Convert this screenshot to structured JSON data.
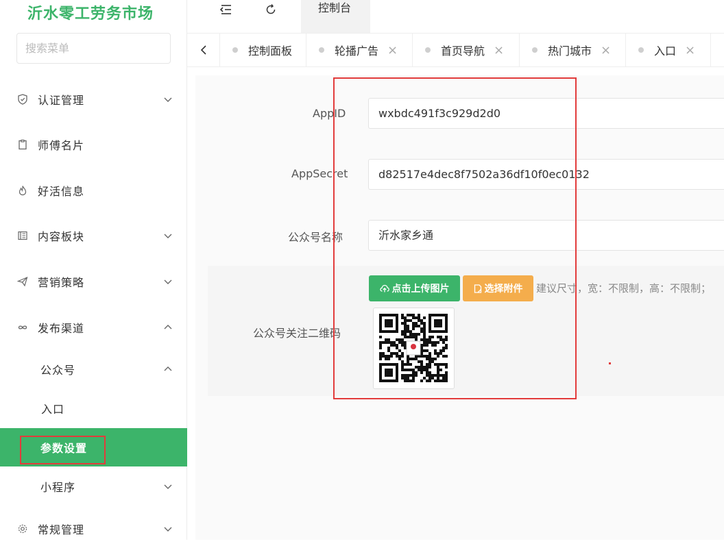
{
  "sidebar": {
    "brand": "沂水零工劳务市场",
    "search_placeholder": "搜索菜单",
    "items": [
      {
        "label": "认证管理",
        "icon": "shield-icon"
      },
      {
        "label": "师傅名片",
        "icon": "clipboard-icon"
      },
      {
        "label": "好活信息",
        "icon": "fire-icon"
      },
      {
        "label": "内容板块",
        "icon": "book-icon"
      },
      {
        "label": "营销策略",
        "icon": "send-icon"
      },
      {
        "label": "发布渠道",
        "icon": "infinity-icon"
      },
      {
        "label": "公众号"
      },
      {
        "label": "入口"
      },
      {
        "label": "参数设置"
      },
      {
        "label": "小程序"
      },
      {
        "label": "常规管理",
        "icon": "gear-icon"
      }
    ]
  },
  "topbar": {
    "active_tab": "控制台"
  },
  "tabs": [
    {
      "label": "控制面板"
    },
    {
      "label": "轮播广告"
    },
    {
      "label": "首页导航"
    },
    {
      "label": "热门城市"
    },
    {
      "label": "入口"
    }
  ],
  "form": {
    "appid_label": "AppID",
    "appid_value": "wxbdc491f3c929d2d0",
    "appsecret_label": "AppSecret",
    "appsecret_value": "d82517e4dec8f7502a36df10f0ec0132",
    "name_label": "公众号名称",
    "name_value": "沂水家乡通",
    "qrcode_label": "公众号关注二维码",
    "upload_button": "点击上传图片",
    "attach_button": "选择附件",
    "hint": "建议尺寸，宽：不限制，高：不限制；"
  },
  "colors": {
    "accent": "#3cb46a",
    "warning": "#f4ad4c",
    "highlight_border": "#e23b3b"
  }
}
